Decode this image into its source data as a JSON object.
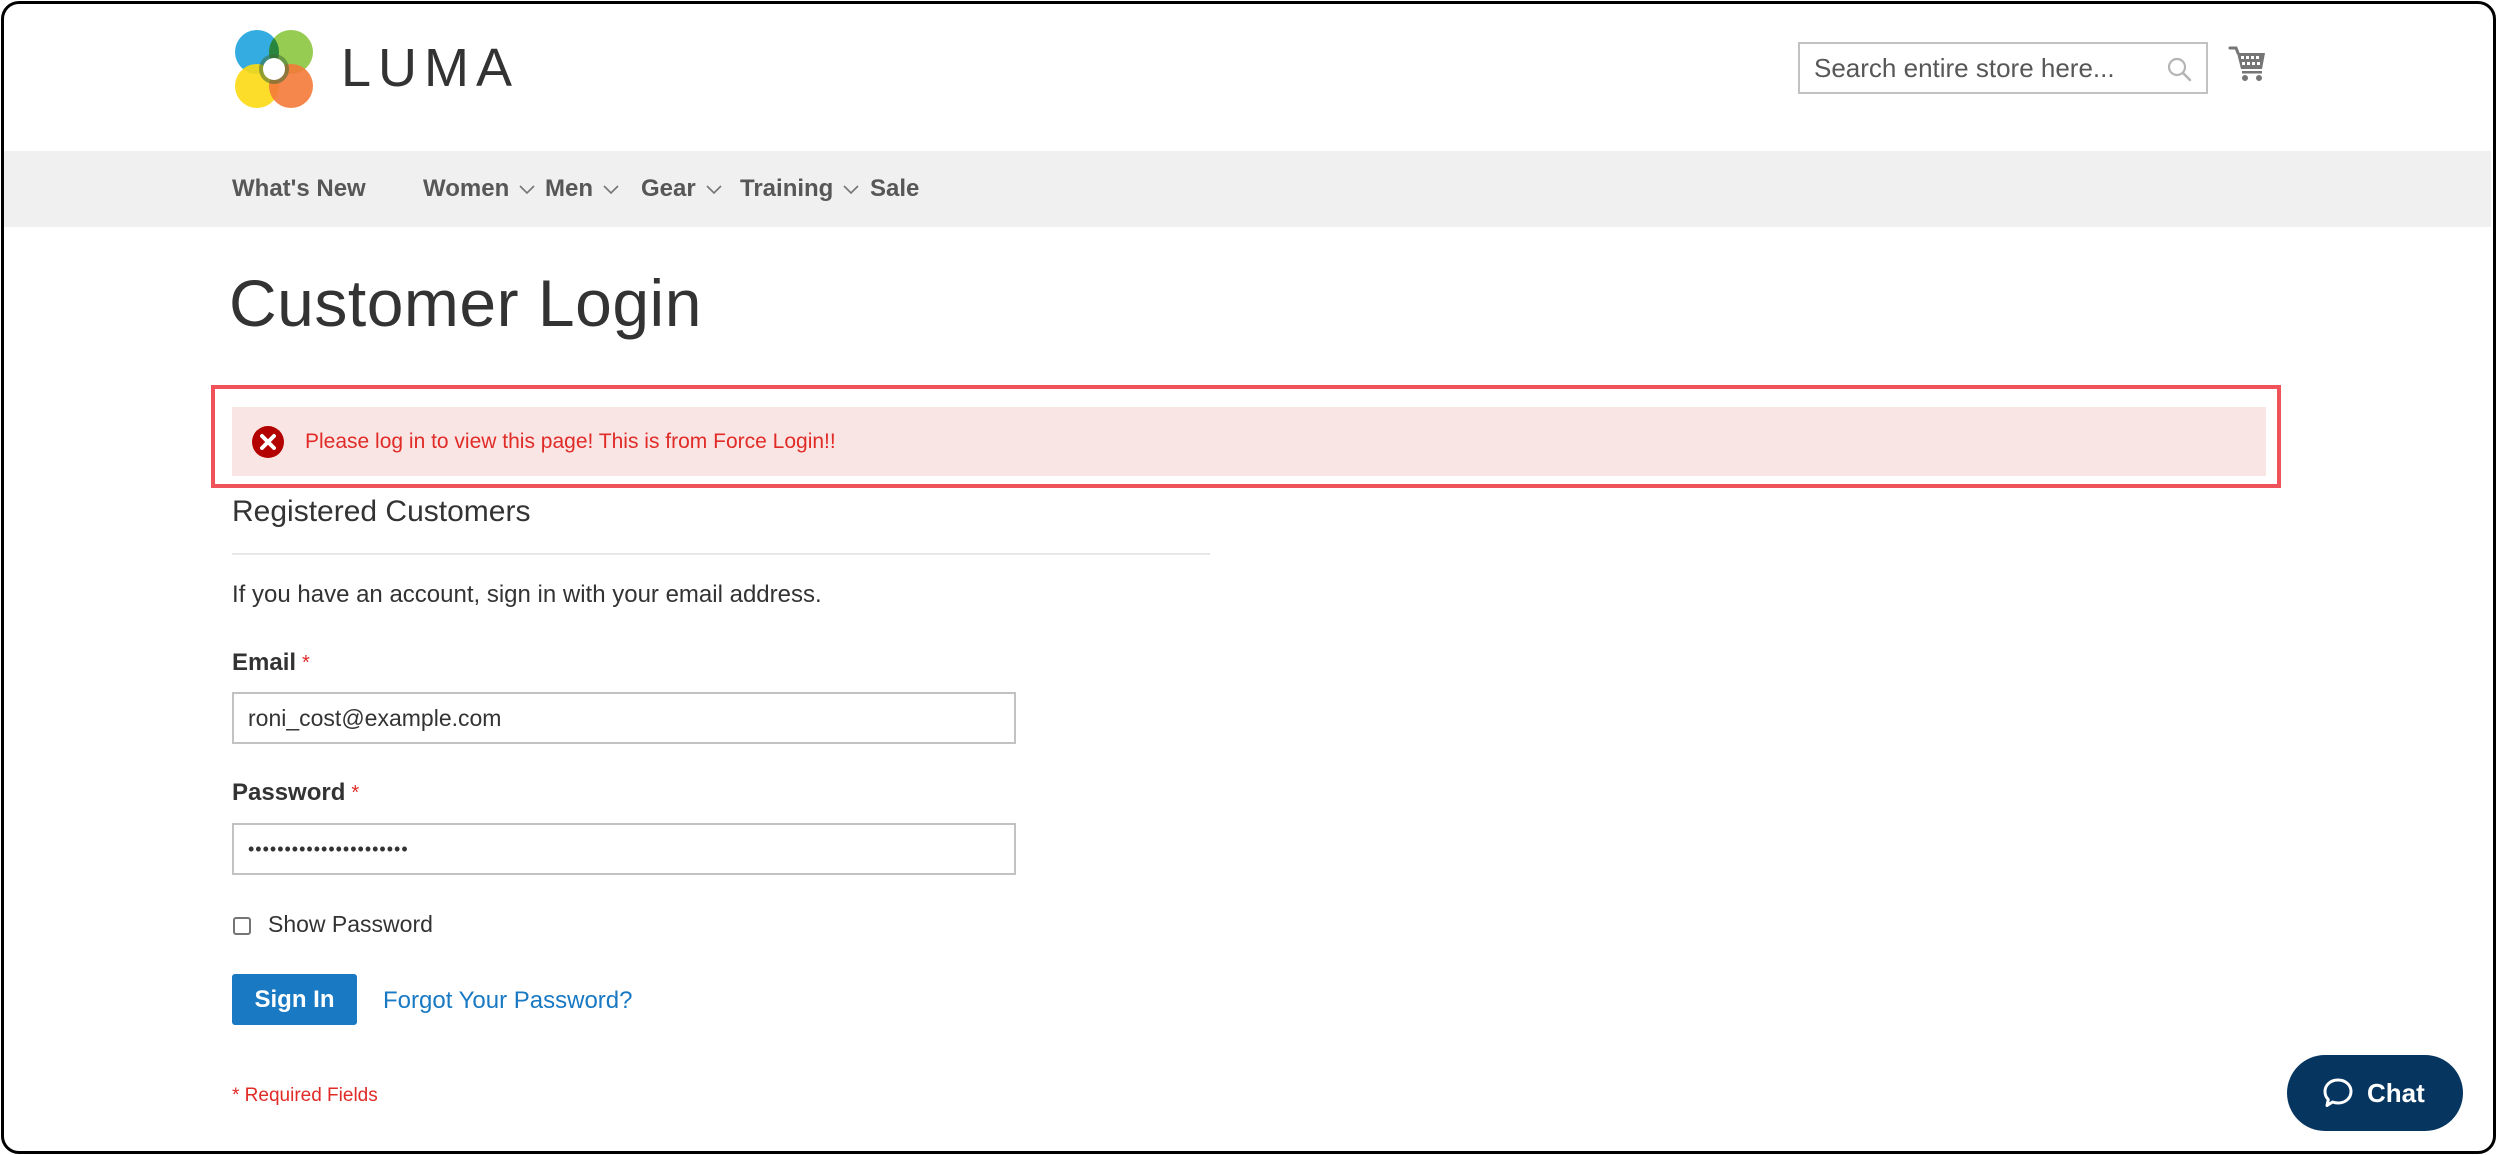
{
  "header": {
    "logo_text": "LUMA",
    "search": {
      "placeholder": "Search entire store here...",
      "value": ""
    },
    "cart_icon": "shopping-cart-icon"
  },
  "nav": {
    "items": [
      {
        "label": "What's New",
        "has_dropdown": false
      },
      {
        "label": "Women",
        "has_dropdown": true
      },
      {
        "label": "Men",
        "has_dropdown": true
      },
      {
        "label": "Gear",
        "has_dropdown": true
      },
      {
        "label": "Training",
        "has_dropdown": true
      },
      {
        "label": "Sale",
        "has_dropdown": false
      }
    ]
  },
  "page": {
    "title": "Customer Login"
  },
  "message": {
    "type": "error",
    "icon": "error-x-icon",
    "text": "Please log in to view this page! This is from Force Login!!"
  },
  "login": {
    "block_title": "Registered Customers",
    "intro": "If you have an account, sign in with your email address.",
    "email": {
      "label": "Email",
      "required_mark": "*",
      "value": "roni_cost@example.com"
    },
    "password": {
      "label": "Password",
      "required_mark": "*",
      "value": "••••••••••••••••••••••"
    },
    "show_password": {
      "label": "Show Password",
      "checked": false
    },
    "sign_in_label": "Sign In",
    "forgot_label": "Forgot Your Password?",
    "required_note": "* Required Fields"
  },
  "chat": {
    "label": "Chat",
    "icon": "chat-bubble-icon"
  },
  "colors": {
    "accent": "#1979c3",
    "error_text": "#e02b27",
    "error_bg": "#fae5e5",
    "highlight_border": "#f0525a",
    "nav_bg": "#f0f0f0",
    "chat_bg": "#063660"
  }
}
